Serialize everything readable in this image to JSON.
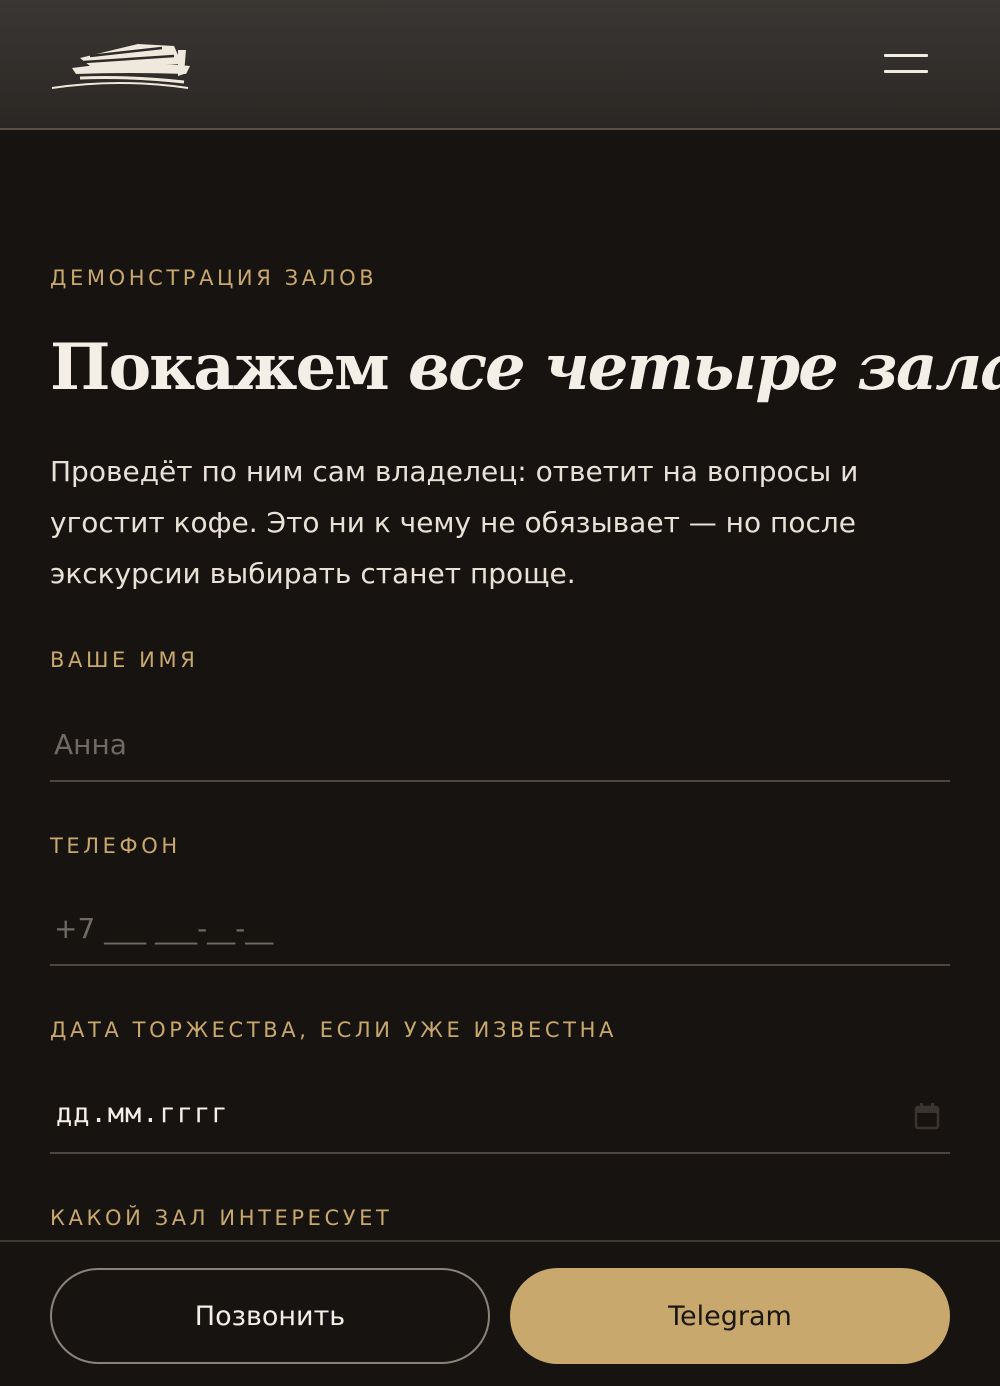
{
  "colors": {
    "background": "#171310",
    "header_background": "#332f2c",
    "accent_gold": "#c8a86c",
    "text_primary": "#f3eee6",
    "text_body": "#e8e1d6",
    "placeholder": "#6f6a64"
  },
  "header": {
    "logo_icon": "ark-boat-logo",
    "menu_icon": "hamburger-menu-icon"
  },
  "section": {
    "eyebrow": "ДЕМОНСТРАЦИЯ ЗАЛОВ",
    "title_plain": "Покажем ",
    "title_italic": "все четыре зала",
    "lead": "Проведёт по ним сам владелец: ответит на вопросы и угостит кофе. Это ни к чему не обязывает — но после экскурсии выбирать станет проще."
  },
  "form": {
    "name": {
      "label": "ВАШЕ ИМЯ",
      "placeholder": "Анна",
      "value": ""
    },
    "phone": {
      "label": "ТЕЛЕФОН",
      "placeholder": "+7 ___ ___-__-__",
      "value": ""
    },
    "date": {
      "label": "ДАТА ТОРЖЕСТВА, ЕСЛИ УЖЕ ИЗВЕСТНА",
      "value": "дд.мм.гггг",
      "icon": "calendar-icon"
    },
    "hall": {
      "label": "КАКОЙ ЗАЛ ИНТЕРЕСУЕТ"
    }
  },
  "actions": {
    "call_label": "Позвонить",
    "telegram_label": "Telegram"
  }
}
